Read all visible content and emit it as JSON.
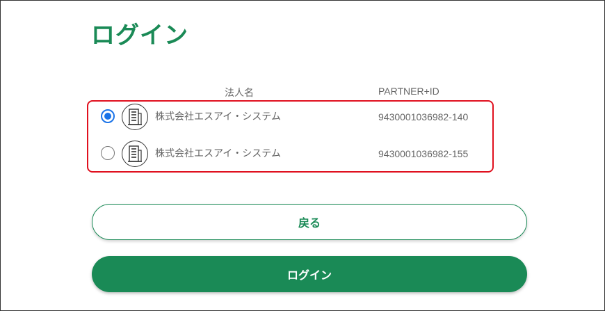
{
  "page": {
    "title": "ログイン"
  },
  "table": {
    "headers": {
      "name": "法人名",
      "partner_id": "PARTNER+ID"
    },
    "rows": [
      {
        "name": "株式会社エスアイ・システム",
        "partner_id": "9430001036982-140",
        "selected": true,
        "icon": "building-icon"
      },
      {
        "name": "株式会社エスアイ・システム",
        "partner_id": "9430001036982-155",
        "selected": false,
        "icon": "building-icon"
      }
    ]
  },
  "buttons": {
    "back_label": "戻る",
    "login_label": "ログイン"
  },
  "colors": {
    "brand_green": "#1a8a56",
    "radio_blue": "#1a73e8",
    "highlight_red": "#e0101e"
  }
}
